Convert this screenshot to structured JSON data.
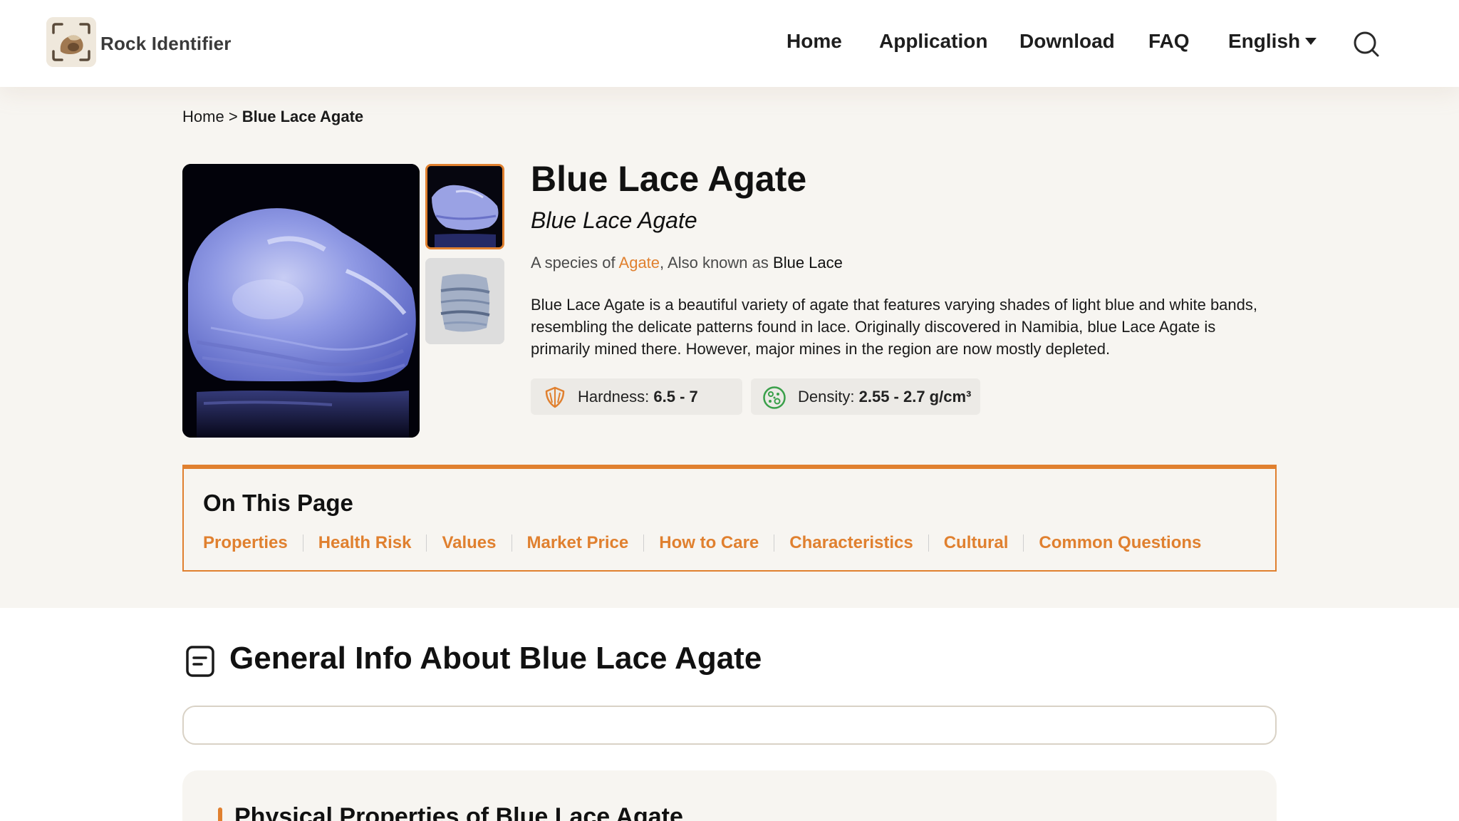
{
  "header": {
    "brand": "Rock Identifier",
    "nav": {
      "home": "Home",
      "application": "Application",
      "download": "Download",
      "faq": "FAQ",
      "language": "English"
    }
  },
  "breadcrumb": {
    "home": "Home",
    "separator": ">",
    "current": "Blue Lace Agate"
  },
  "rock": {
    "name": "Blue Lace Agate",
    "scientific_name": "Blue Lace Agate",
    "species_prefix": "A species of ",
    "species_link": "Agate",
    "aka_prefix": ", Also known as ",
    "aka": "Blue Lace",
    "description": "Blue Lace Agate is a beautiful variety of agate that features varying shades of light blue and white bands, resembling the delicate patterns found in lace. Originally discovered in Namibia, blue Lace Agate is primarily mined there. However, major mines in the region are now mostly depleted.",
    "hardness_label": "Hardness:",
    "hardness_value": "6.5 - 7",
    "density_label": "Density:",
    "density_value": "2.55 - 2.7 g/cm³"
  },
  "on_this_page": {
    "title": "On This Page",
    "links": [
      "Properties",
      "Health Risk",
      "Values",
      "Market Price",
      "How to Care",
      "Characteristics",
      "Cultural",
      "Common Questions"
    ]
  },
  "general_info": {
    "title": "General Info About Blue Lace Agate",
    "card_title": "Physical Properties of Blue Lace Agate"
  },
  "colors": {
    "accent": "#e0802f",
    "page_bg": "#f7f5f1",
    "header_bg": "#ffffff"
  },
  "icons": [
    "rock-identifier-logo-icon",
    "search-icon",
    "caret-down-icon",
    "hardness-shield-icon",
    "density-dots-icon",
    "document-icon"
  ]
}
